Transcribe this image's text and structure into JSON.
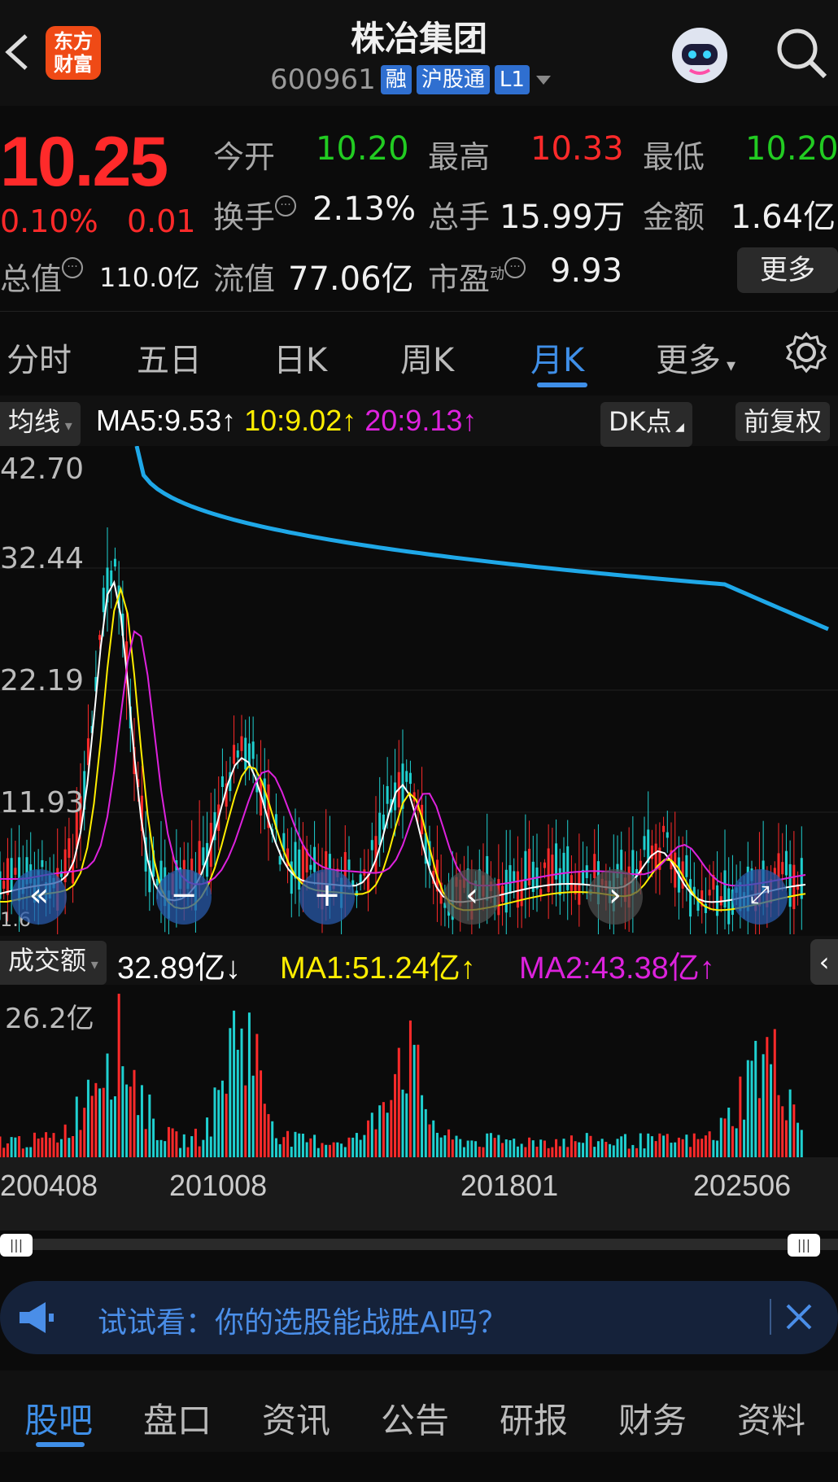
{
  "header": {
    "logo_line1": "东方",
    "logo_line2": "财富",
    "title": "株冶集团",
    "code": "600961",
    "tags": [
      "融",
      "沪股通",
      "L1"
    ]
  },
  "quote": {
    "price": "10.25",
    "change_pct": "0.10%",
    "change": "0.01",
    "open_label": "今开",
    "open": "10.20",
    "high_label": "最高",
    "high": "10.33",
    "low_label": "最低",
    "low": "10.20",
    "turnover_label": "换手",
    "turnover": "2.13%",
    "volume_label": "总手",
    "volume": "15.99万",
    "amount_label": "金额",
    "amount": "1.64亿",
    "mktcap_label": "总值",
    "mktcap": "110.0亿",
    "float_label": "流值",
    "float_cap": "77.06亿",
    "pe_label": "市盈",
    "pe_sup": "动",
    "pe": "9.93",
    "more": "更多"
  },
  "tabs": [
    "分时",
    "五日",
    "日K",
    "周K",
    "月K",
    "更多"
  ],
  "active_tab": "月K",
  "ma_bar": {
    "selector": "均线",
    "ma5": "MA5:9.53↑",
    "ma10": "10:9.02↑",
    "ma20": "20:9.13↑",
    "dk": "DK点",
    "adjust": "前复权"
  },
  "price_axis": [
    "42.70",
    "32.44",
    "22.19",
    "11.93",
    "1.6"
  ],
  "volume_bar": {
    "selector": "成交额",
    "value": "32.89亿↓",
    "ma1": "MA1:51.24亿↑",
    "ma2": "MA2:43.38亿↑",
    "axis_max": "26.2亿"
  },
  "x_labels": [
    "200408",
    "201008",
    "201801",
    "202506"
  ],
  "promo": {
    "text": "试试看：你的选股能战胜AI吗？"
  },
  "bottom_tabs": [
    "股吧",
    "盘口",
    "资讯",
    "公告",
    "研报",
    "财务",
    "资料"
  ],
  "colors": {
    "up": "#ff2a2a",
    "down": "#22cc22",
    "accent": "#3f8fe8",
    "ma5": "#ffffff",
    "ma10": "#ffee00",
    "ma20": "#dd22dd",
    "long_ma": "#1fa8e8",
    "down_bar": "#1fd0d0"
  }
}
